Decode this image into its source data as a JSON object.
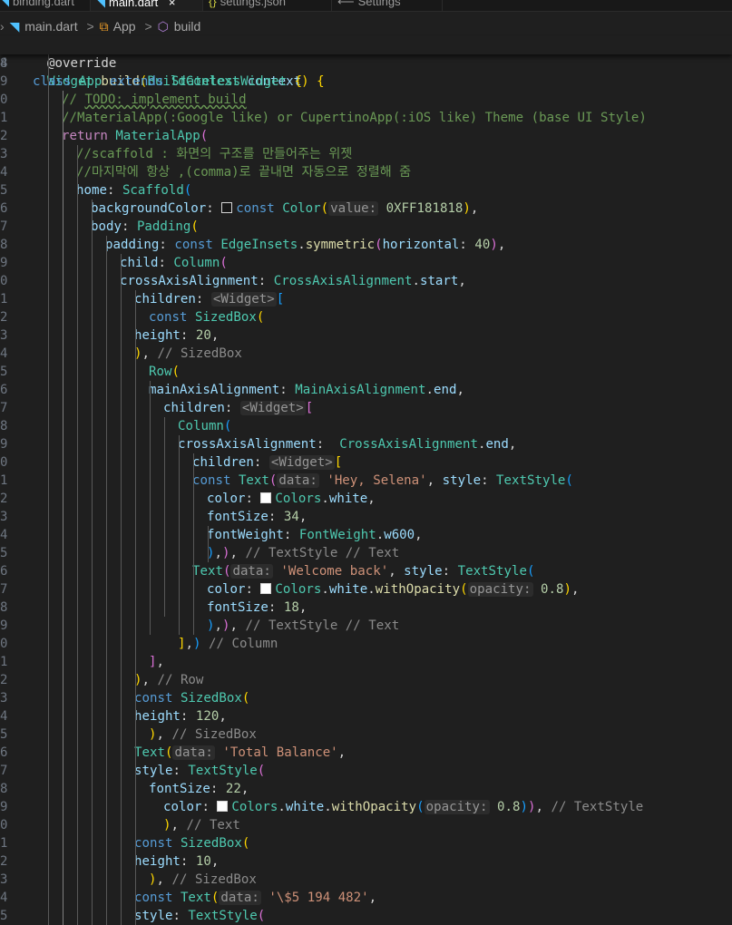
{
  "tabs": [
    {
      "label": "binding.dart",
      "icon": "dart-icon",
      "active": false
    },
    {
      "label": "main.dart",
      "icon": "dart-icon",
      "active": true,
      "close": "×"
    },
    {
      "label": "settings.json",
      "icon": "json-icon",
      "active": false
    },
    {
      "label": "Settings",
      "icon": "settings-icon",
      "active": false
    }
  ],
  "breadcrumb": {
    "file": "main.dart",
    "cls": "App",
    "method": "build",
    "sep": ">"
  },
  "sticky": {
    "ln": "4",
    "text": "class App extends StatelessWidget {"
  },
  "colors": {
    "bg": "#1f1f1f",
    "swatch_black": "#181818",
    "swatch_white": "#ffffff"
  },
  "lines": [
    {
      "ln": "8",
      "tokens": [
        [
          "ann",
          "@override"
        ]
      ]
    },
    {
      "ln": "9",
      "tokens": [
        [
          "type",
          "Widget"
        ],
        [
          "punc",
          " "
        ],
        [
          "func",
          "build"
        ],
        [
          "br1",
          "("
        ],
        [
          "type",
          "BuildContext"
        ],
        [
          "punc",
          " "
        ],
        [
          "prop",
          "context"
        ],
        [
          "br1",
          ")"
        ],
        [
          "punc",
          " "
        ],
        [
          "br1",
          "{"
        ]
      ]
    },
    {
      "ln": "0",
      "tokens": [
        [
          "com",
          "// "
        ],
        [
          "todo",
          "TODO: implement build"
        ]
      ]
    },
    {
      "ln": "1",
      "tokens": [
        [
          "com",
          "//MaterialApp(:Google like) or CupertinoApp(:iOS like) Theme (base UI Style)"
        ]
      ]
    },
    {
      "ln": "2",
      "tokens": [
        [
          "ctrl",
          "return"
        ],
        [
          "punc",
          " "
        ],
        [
          "type",
          "MaterialApp"
        ],
        [
          "br2",
          "("
        ]
      ]
    },
    {
      "ln": "3",
      "tokens": [
        [
          "com",
          "//scaffold : 화면의 구조를 만들어주는 위젯"
        ]
      ]
    },
    {
      "ln": "4",
      "tokens": [
        [
          "com",
          "//마지막에 항상 ,(comma)로 끝내면 자동으로 정렬해 줌"
        ]
      ]
    },
    {
      "ln": "5",
      "tokens": [
        [
          "prop",
          "home"
        ],
        [
          "punc",
          ": "
        ],
        [
          "type",
          "Scaffold"
        ],
        [
          "br3",
          "("
        ]
      ]
    },
    {
      "ln": "6",
      "tokens": [
        [
          "prop",
          "backgroundColor"
        ],
        [
          "punc",
          ": "
        ],
        [
          "swatch",
          "#181818"
        ],
        [
          "kw",
          "const"
        ],
        [
          "punc",
          " "
        ],
        [
          "type",
          "Color"
        ],
        [
          "br1",
          "("
        ],
        [
          "hint",
          "value:"
        ],
        [
          "punc",
          " "
        ],
        [
          "num",
          "0XFF181818"
        ],
        [
          "br1",
          ")"
        ],
        [
          "punc",
          ","
        ]
      ]
    },
    {
      "ln": "7",
      "tokens": [
        [
          "prop",
          "body"
        ],
        [
          "punc",
          ": "
        ],
        [
          "type",
          "Padding"
        ],
        [
          "br1",
          "("
        ]
      ]
    },
    {
      "ln": "8",
      "tokens": [
        [
          "prop",
          "padding"
        ],
        [
          "punc",
          ": "
        ],
        [
          "kw",
          "const"
        ],
        [
          "punc",
          " "
        ],
        [
          "type",
          "EdgeInsets"
        ],
        [
          "punc",
          "."
        ],
        [
          "func",
          "symmetric"
        ],
        [
          "br2",
          "("
        ],
        [
          "prop",
          "horizontal"
        ],
        [
          "punc",
          ": "
        ],
        [
          "num",
          "40"
        ],
        [
          "br2",
          ")"
        ],
        [
          "punc",
          ","
        ]
      ]
    },
    {
      "ln": "9",
      "tokens": [
        [
          "prop",
          "child"
        ],
        [
          "punc",
          ": "
        ],
        [
          "type",
          "Column"
        ],
        [
          "br2",
          "("
        ]
      ]
    },
    {
      "ln": "0",
      "tokens": [
        [
          "prop",
          "crossAxisAlignment"
        ],
        [
          "punc",
          ": "
        ],
        [
          "type",
          "CrossAxisAlignment"
        ],
        [
          "punc",
          "."
        ],
        [
          "prop",
          "start"
        ],
        [
          "punc",
          ","
        ]
      ]
    },
    {
      "ln": "1",
      "tokens": [
        [
          "prop",
          "children"
        ],
        [
          "punc",
          ": "
        ],
        [
          "hint",
          "<Widget>"
        ],
        [
          "br3",
          "["
        ]
      ]
    },
    {
      "ln": "2",
      "tokens": [
        [
          "kw",
          "const"
        ],
        [
          "punc",
          " "
        ],
        [
          "type",
          "SizedBox"
        ],
        [
          "br1",
          "("
        ]
      ]
    },
    {
      "ln": "3",
      "tokens": [
        [
          "prop",
          "height"
        ],
        [
          "punc",
          ": "
        ],
        [
          "num",
          "20"
        ],
        [
          "punc",
          ","
        ]
      ]
    },
    {
      "ln": "4",
      "tokens": [
        [
          "br1",
          ")"
        ],
        [
          "punc",
          ", "
        ],
        [
          "closing",
          "// SizedBox"
        ]
      ]
    },
    {
      "ln": "5",
      "tokens": [
        [
          "type",
          "Row"
        ],
        [
          "br1",
          "("
        ]
      ]
    },
    {
      "ln": "6",
      "tokens": [
        [
          "prop",
          "mainAxisAlignment"
        ],
        [
          "punc",
          ": "
        ],
        [
          "type",
          "MainAxisAlignment"
        ],
        [
          "punc",
          "."
        ],
        [
          "prop",
          "end"
        ],
        [
          "punc",
          ","
        ]
      ]
    },
    {
      "ln": "7",
      "tokens": [
        [
          "prop",
          "children"
        ],
        [
          "punc",
          ": "
        ],
        [
          "hint",
          "<Widget>"
        ],
        [
          "br2",
          "["
        ]
      ]
    },
    {
      "ln": "8",
      "tokens": [
        [
          "type",
          "Column"
        ],
        [
          "br3",
          "("
        ]
      ]
    },
    {
      "ln": "9",
      "tokens": [
        [
          "prop",
          "crossAxisAlignment"
        ],
        [
          "punc",
          ":  "
        ],
        [
          "type",
          "CrossAxisAlignment"
        ],
        [
          "punc",
          "."
        ],
        [
          "prop",
          "end"
        ],
        [
          "punc",
          ","
        ]
      ]
    },
    {
      "ln": "0",
      "tokens": [
        [
          "prop",
          "children"
        ],
        [
          "punc",
          ": "
        ],
        [
          "hint",
          "<Widget>"
        ],
        [
          "br1",
          "["
        ]
      ]
    },
    {
      "ln": "1",
      "tokens": [
        [
          "kw",
          "const"
        ],
        [
          "punc",
          " "
        ],
        [
          "type",
          "Text"
        ],
        [
          "br2",
          "("
        ],
        [
          "hint",
          "data:"
        ],
        [
          "punc",
          " "
        ],
        [
          "str",
          "'Hey, Selena'"
        ],
        [
          "punc",
          ", "
        ],
        [
          "prop",
          "style"
        ],
        [
          "punc",
          ": "
        ],
        [
          "type",
          "TextStyle"
        ],
        [
          "br3",
          "("
        ]
      ]
    },
    {
      "ln": "2",
      "tokens": [
        [
          "prop",
          "color"
        ],
        [
          "punc",
          ": "
        ],
        [
          "swatch",
          "#ffffff"
        ],
        [
          "type",
          "Colors"
        ],
        [
          "punc",
          "."
        ],
        [
          "prop",
          "white"
        ],
        [
          "punc",
          ","
        ]
      ]
    },
    {
      "ln": "3",
      "tokens": [
        [
          "prop",
          "fontSize"
        ],
        [
          "punc",
          ": "
        ],
        [
          "num",
          "34"
        ],
        [
          "punc",
          ","
        ]
      ]
    },
    {
      "ln": "4",
      "tokens": [
        [
          "prop",
          "fontWeight"
        ],
        [
          "punc",
          ": "
        ],
        [
          "type",
          "FontWeight"
        ],
        [
          "punc",
          "."
        ],
        [
          "prop",
          "w600"
        ],
        [
          "punc",
          ","
        ]
      ]
    },
    {
      "ln": "5",
      "tokens": [
        [
          "br3",
          ")"
        ],
        [
          "punc",
          ","
        ],
        [
          "br2",
          ")"
        ],
        [
          "punc",
          ", "
        ],
        [
          "closing",
          "// TextStyle // Text"
        ]
      ]
    },
    {
      "ln": "6",
      "tokens": [
        [
          "type",
          "Text"
        ],
        [
          "br2",
          "("
        ],
        [
          "hint",
          "data:"
        ],
        [
          "punc",
          " "
        ],
        [
          "str",
          "'Welcome back'"
        ],
        [
          "punc",
          ", "
        ],
        [
          "prop",
          "style"
        ],
        [
          "punc",
          ": "
        ],
        [
          "type",
          "TextStyle"
        ],
        [
          "br3",
          "("
        ]
      ]
    },
    {
      "ln": "7",
      "tokens": [
        [
          "prop",
          "color"
        ],
        [
          "punc",
          ": "
        ],
        [
          "swatch",
          "#ffffff"
        ],
        [
          "type",
          "Colors"
        ],
        [
          "punc",
          "."
        ],
        [
          "prop",
          "white"
        ],
        [
          "punc",
          "."
        ],
        [
          "func",
          "withOpacity"
        ],
        [
          "br1",
          "("
        ],
        [
          "hint",
          "opacity:"
        ],
        [
          "punc",
          " "
        ],
        [
          "num",
          "0.8"
        ],
        [
          "br1",
          ")"
        ],
        [
          "punc",
          ","
        ]
      ]
    },
    {
      "ln": "8",
      "tokens": [
        [
          "prop",
          "fontSize"
        ],
        [
          "punc",
          ": "
        ],
        [
          "num",
          "18"
        ],
        [
          "punc",
          ","
        ]
      ]
    },
    {
      "ln": "9",
      "tokens": [
        [
          "br3",
          ")"
        ],
        [
          "punc",
          ","
        ],
        [
          "br2",
          ")"
        ],
        [
          "punc",
          ", "
        ],
        [
          "closing",
          "// TextStyle // Text"
        ]
      ]
    },
    {
      "ln": "0",
      "tokens": [
        [
          "br1",
          "]"
        ],
        [
          "punc",
          ","
        ],
        [
          "br3",
          ")"
        ],
        [
          "punc",
          " "
        ],
        [
          "closing",
          "// Column"
        ]
      ]
    },
    {
      "ln": "1",
      "tokens": [
        [
          "br2",
          "]"
        ],
        [
          "punc",
          ","
        ]
      ]
    },
    {
      "ln": "2",
      "tokens": [
        [
          "br1",
          ")"
        ],
        [
          "punc",
          ", "
        ],
        [
          "closing",
          "// Row"
        ]
      ]
    },
    {
      "ln": "3",
      "tokens": [
        [
          "kw",
          "const"
        ],
        [
          "punc",
          " "
        ],
        [
          "type",
          "SizedBox"
        ],
        [
          "br1",
          "("
        ]
      ]
    },
    {
      "ln": "4",
      "tokens": [
        [
          "prop",
          "height"
        ],
        [
          "punc",
          ": "
        ],
        [
          "num",
          "120"
        ],
        [
          "punc",
          ","
        ]
      ]
    },
    {
      "ln": "5",
      "tokens": [
        [
          "br1",
          ")"
        ],
        [
          "punc",
          ", "
        ],
        [
          "closing",
          "// SizedBox"
        ]
      ]
    },
    {
      "ln": "6",
      "tokens": [
        [
          "type",
          "Text"
        ],
        [
          "br1",
          "("
        ],
        [
          "hint",
          "data:"
        ],
        [
          "punc",
          " "
        ],
        [
          "str",
          "'Total Balance'"
        ],
        [
          "punc",
          ","
        ]
      ]
    },
    {
      "ln": "7",
      "tokens": [
        [
          "prop",
          "style"
        ],
        [
          "punc",
          ": "
        ],
        [
          "type",
          "TextStyle"
        ],
        [
          "br2",
          "("
        ]
      ]
    },
    {
      "ln": "8",
      "tokens": [
        [
          "prop",
          "fontSize"
        ],
        [
          "punc",
          ": "
        ],
        [
          "num",
          "22"
        ],
        [
          "punc",
          ","
        ]
      ]
    },
    {
      "ln": "9",
      "tokens": [
        [
          "prop",
          "color"
        ],
        [
          "punc",
          ": "
        ],
        [
          "swatch",
          "#ffffff"
        ],
        [
          "type",
          "Colors"
        ],
        [
          "punc",
          "."
        ],
        [
          "prop",
          "white"
        ],
        [
          "punc",
          "."
        ],
        [
          "func",
          "withOpacity"
        ],
        [
          "br3",
          "("
        ],
        [
          "hint",
          "opacity:"
        ],
        [
          "punc",
          " "
        ],
        [
          "num",
          "0.8"
        ],
        [
          "br3",
          ")"
        ],
        [
          "br2",
          ")"
        ],
        [
          "punc",
          ", "
        ],
        [
          "closing",
          "// TextStyle"
        ]
      ]
    },
    {
      "ln": "0",
      "tokens": [
        [
          "br1",
          ")"
        ],
        [
          "punc",
          ", "
        ],
        [
          "closing",
          "// Text"
        ]
      ]
    },
    {
      "ln": "1",
      "tokens": [
        [
          "kw",
          "const"
        ],
        [
          "punc",
          " "
        ],
        [
          "type",
          "SizedBox"
        ],
        [
          "br1",
          "("
        ]
      ]
    },
    {
      "ln": "2",
      "tokens": [
        [
          "prop",
          "height"
        ],
        [
          "punc",
          ": "
        ],
        [
          "num",
          "10"
        ],
        [
          "punc",
          ","
        ]
      ]
    },
    {
      "ln": "3",
      "tokens": [
        [
          "br1",
          ")"
        ],
        [
          "punc",
          ", "
        ],
        [
          "closing",
          "// SizedBox"
        ]
      ]
    },
    {
      "ln": "4",
      "tokens": [
        [
          "kw",
          "const"
        ],
        [
          "punc",
          " "
        ],
        [
          "type",
          "Text"
        ],
        [
          "br1",
          "("
        ],
        [
          "hint",
          "data:"
        ],
        [
          "punc",
          " "
        ],
        [
          "str",
          "'\\$5 194 482'"
        ],
        [
          "punc",
          ","
        ]
      ]
    },
    {
      "ln": "5",
      "tokens": [
        [
          "prop",
          "style"
        ],
        [
          "punc",
          ": "
        ],
        [
          "type",
          "TextStyle"
        ],
        [
          "br2",
          "("
        ]
      ]
    }
  ]
}
